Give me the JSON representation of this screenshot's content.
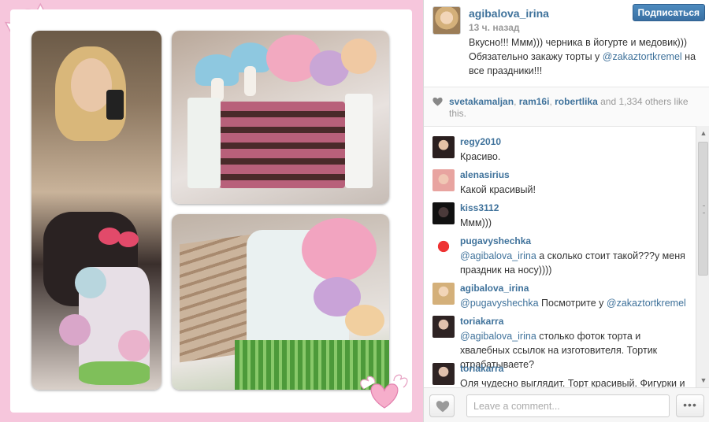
{
  "post": {
    "username": "agibalova_irina",
    "timestamp": "13 ч. назад",
    "caption_part1": "Вкусно!!! Ммм))) черника в йогурте и медовик))) Обязательно закажу торты у ",
    "caption_mention": "@zakaztortkremel",
    "caption_part2": " на все праздники!!!",
    "follow_label": "Подписаться"
  },
  "likes": {
    "user1": "svetakamaljan",
    "sep1": ", ",
    "user2": "ram16i",
    "sep2": ", ",
    "user3": "robertlika",
    "and": " and ",
    "count": "1,334",
    "others": " others like this."
  },
  "comments": [
    {
      "user": "regy2010",
      "mention": "",
      "text": "Красиво."
    },
    {
      "user": "alenasirius",
      "mention": "",
      "text": "Какой красивый!"
    },
    {
      "user": "kiss3112",
      "mention": "",
      "text": "Ммм)))"
    },
    {
      "user": "pugavyshechka",
      "mention": "@agibalova_irina",
      "text": " а сколько стоит такой???у меня праздник на носу))))"
    },
    {
      "user": "agibalova_irina",
      "mention": "@pugavyshechka",
      "text": " Посмотрите у ",
      "mention2": "@zakaztortkremel"
    },
    {
      "user": "toriakarra",
      "mention": "@agibalova_irina",
      "text": " столько фоток торта и хвалебных ссылок на изготовителя. Тортик отрабатываете?"
    },
    {
      "user": "toriakarra",
      "mention": "",
      "text": "Оля чудесно выглядит. Торт красивый. Фигурки и"
    }
  ],
  "footer": {
    "comment_placeholder": "Leave a comment...",
    "more_label": "•••"
  },
  "colors": {
    "link": "#3f729b",
    "frame_pink": "#f6c6dc",
    "follow_button": "#3a70a3"
  }
}
